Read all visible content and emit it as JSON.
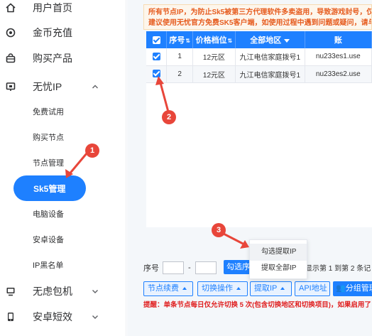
{
  "sidebar": {
    "items": [
      {
        "label": "用户首页",
        "icon": "home-icon"
      },
      {
        "label": "金币充值",
        "icon": "coin-icon"
      },
      {
        "label": "购买产品",
        "icon": "bag-icon"
      },
      {
        "label": "无忧IP",
        "icon": "monitor-icon"
      },
      {
        "label": "无虑包机",
        "icon": "desktop-icon"
      },
      {
        "label": "安卓短效",
        "icon": "phone-icon"
      }
    ],
    "sub_items": [
      {
        "label": "免费试用"
      },
      {
        "label": "购买节点"
      },
      {
        "label": "节点管理"
      },
      {
        "label": "Sk5管理"
      },
      {
        "label": "电脑设备"
      },
      {
        "label": "安卓设备"
      },
      {
        "label": "IP黑名单"
      }
    ]
  },
  "notice": {
    "line1": "所有节点IP，为防止Sk5被第三方代理软件多卖盗用，导致游戏封号，仅",
    "line2": "建议使用无忧官方免费SK5客户端，如使用过程中遇到问题或疑问，请与"
  },
  "table": {
    "columns": [
      "序号",
      "价格档位",
      "全部地区",
      "账"
    ],
    "rows": [
      {
        "no": "1",
        "price": "12元区",
        "region": "九江电信家庭拨号1",
        "account": "nu233es1.use"
      },
      {
        "no": "2",
        "price": "12元区",
        "region": "九江电信家庭拨号1",
        "account": "nu233es2.use"
      }
    ]
  },
  "pager": {
    "label": "序号",
    "dash": "-",
    "pick_label": "勾选序号",
    "info": "显示第 1 到第 2 条记"
  },
  "toolbar": {
    "renew": "节点续费",
    "switch": "切换操作",
    "extract": "提取IP",
    "api": "API地址",
    "group": "分组管理"
  },
  "warning": "提醒：单条节点每日仅允许切换 5 次(包含切换地区和切换项目)，如果启用了",
  "menu": {
    "items": [
      "勾选提取IP",
      "提取全部IP"
    ]
  },
  "annotations": [
    "1",
    "2",
    "3"
  ],
  "colors": {
    "accent": "#1e80ff",
    "annotation": "#e8463a",
    "notice_text": "#e65c1f",
    "warning_text": "#e02020"
  }
}
